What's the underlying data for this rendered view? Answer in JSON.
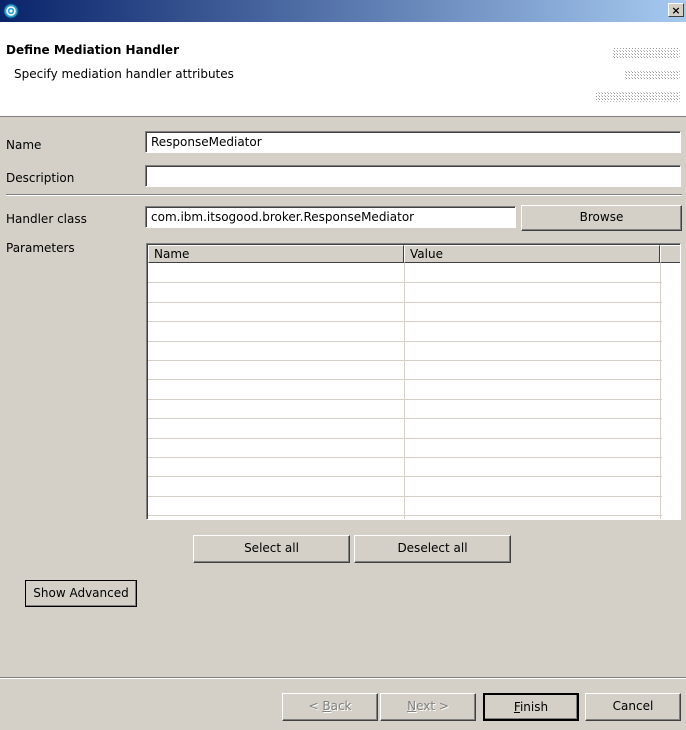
{
  "window": {
    "app_icon": "eclipse-wizard-icon",
    "close_glyph": "×"
  },
  "header": {
    "title": "Define Mediation Handler",
    "subtitle": "Specify mediation handler attributes"
  },
  "form": {
    "name_label": "Name",
    "name_value": "ResponseMediator",
    "description_label": "Description",
    "description_value": "",
    "handler_class_label": "Handler class",
    "handler_class_value": "com.ibm.itsogood.broker.ResponseMediator",
    "browse_label": "Browse",
    "parameters_label": "Parameters"
  },
  "parameters_table": {
    "columns": [
      "Name",
      "Value"
    ],
    "rows": []
  },
  "selection": {
    "select_all_label": "Select all",
    "deselect_all_label": "Deselect all"
  },
  "advanced": {
    "show_advanced_label": "Show Advanced"
  },
  "footer": {
    "back_prefix": "< ",
    "back_mnemonic": "B",
    "back_rest": "ack",
    "next_mnemonic": "N",
    "next_rest": "ext >",
    "finish_mnemonic": "F",
    "finish_rest": "inish",
    "cancel_label": "Cancel"
  },
  "colors": {
    "titlebar_start": "#0a246a",
    "titlebar_end": "#a6caf0",
    "dialog_bg": "#d4d0c8",
    "header_bg": "#ffffff"
  }
}
